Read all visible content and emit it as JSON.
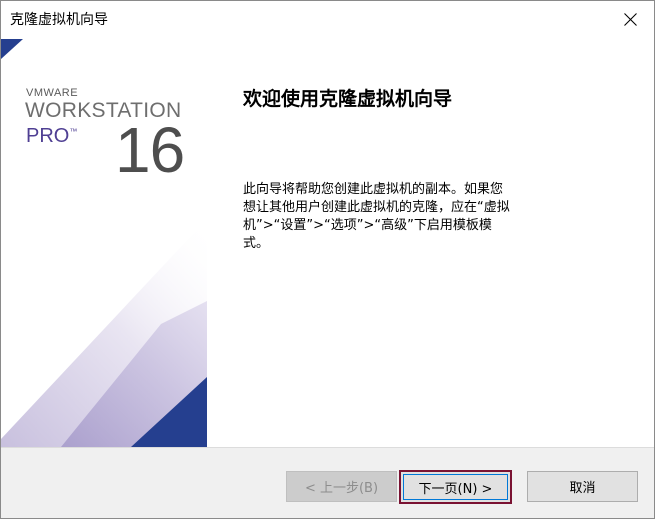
{
  "window": {
    "title": "克隆虚拟机向导"
  },
  "banner": {
    "vendor": "VMWARE",
    "product": "WORKSTATION",
    "edition": "PRO",
    "trademark": "™",
    "version": "16"
  },
  "content": {
    "heading": "欢迎使用克隆虚拟机向导",
    "description": "此向导将帮助您创建此虚拟机的副本。如果您想让其他用户创建此虚拟机的克隆，应在“虚拟机”>“设置”>“选项”>“高级”下启用模板模式。"
  },
  "buttons": {
    "back_label": "< 上一步(B)",
    "next_label": "下一页(N) >",
    "cancel_label": "取消"
  },
  "icons": {
    "close": "close-icon"
  },
  "colors": {
    "brand_purple": "#4f3f93",
    "banner_navy": "#253f8f",
    "focus_border": "#7a1232"
  }
}
